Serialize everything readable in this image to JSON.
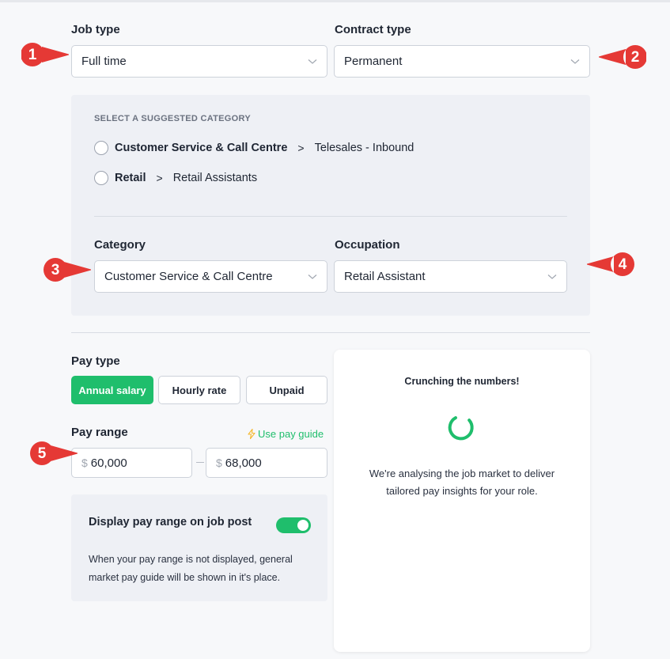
{
  "job_type": {
    "label": "Job type",
    "value": "Full time"
  },
  "contract_type": {
    "label": "Contract type",
    "value": "Permanent"
  },
  "suggested": {
    "heading": "SELECT A SUGGESTED CATEGORY",
    "options": [
      {
        "category": "Customer Service & Call Centre",
        "separator": ">",
        "occupation": "Telesales - Inbound"
      },
      {
        "category": "Retail",
        "separator": ">",
        "occupation": "Retail Assistants"
      }
    ]
  },
  "category": {
    "label": "Category",
    "value": "Customer Service & Call Centre"
  },
  "occupation": {
    "label": "Occupation",
    "value": "Retail Assistant"
  },
  "pay_type": {
    "label": "Pay type",
    "options": [
      "Annual salary",
      "Hourly rate",
      "Unpaid"
    ],
    "selected": "Annual salary"
  },
  "pay_range": {
    "label": "Pay range",
    "guide_link": "Use pay guide",
    "currency": "$",
    "min": "60,000",
    "max": "68,000"
  },
  "display_range": {
    "title": "Display pay range on job post",
    "enabled": true,
    "description": "When your pay range is not displayed, general market pay guide will be shown in it's place."
  },
  "insights": {
    "title": "Crunching the numbers!",
    "description": "We're analysing the job market to deliver tailored pay insights for your role."
  },
  "markers": [
    "1",
    "2",
    "3",
    "4",
    "5"
  ],
  "colors": {
    "accent": "#1fbe6c",
    "marker": "#e53935"
  }
}
